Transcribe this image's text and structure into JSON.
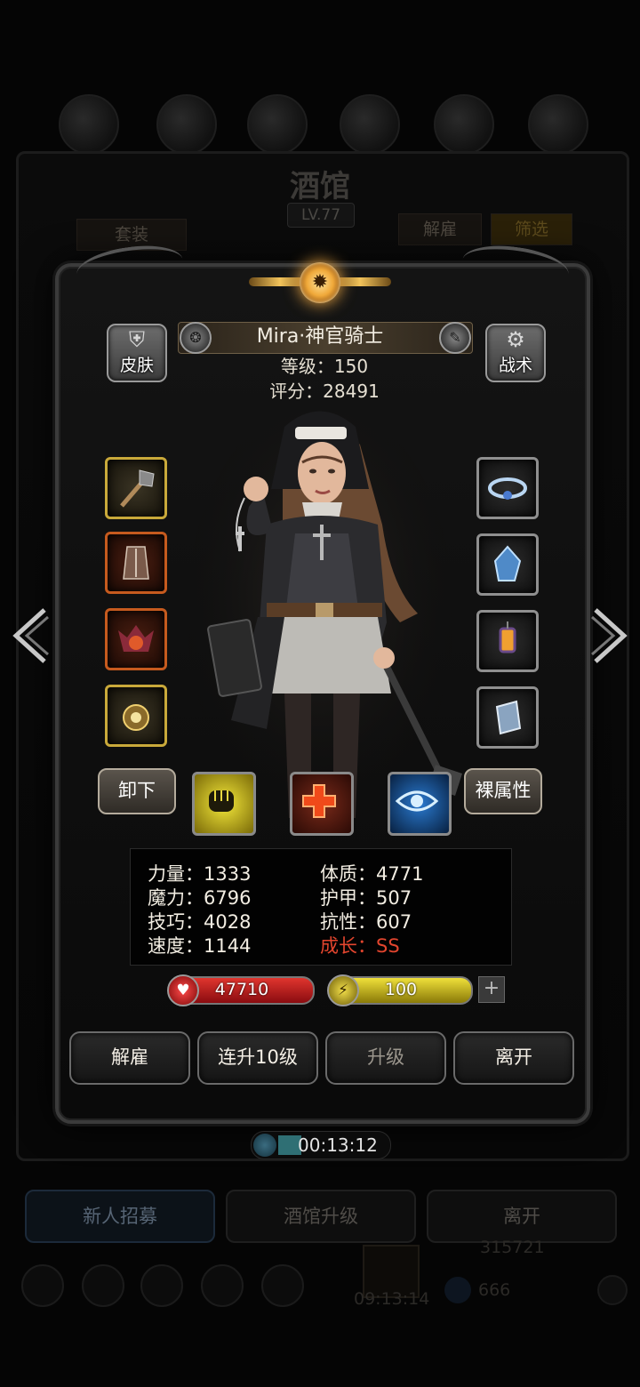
{
  "background": {
    "title": "酒馆",
    "level": "LV.77",
    "btn_set": "套装",
    "btn_dismiss": "解雇",
    "btn_filter": "筛选",
    "bottom_recruit": "新人招募",
    "bottom_upgrade": "酒馆升级",
    "bottom_leave": "离开",
    "gold_amount": "315721",
    "timer2": "09:13:14",
    "gem_amount": "666"
  },
  "hero": {
    "name": "Mira·神官骑士",
    "level_label": "等级：150",
    "score_label": "评分：28491",
    "skin_label": "皮肤",
    "tactics_label": "战术"
  },
  "equip_left": [
    {
      "icon": "mace-icon"
    },
    {
      "icon": "armor-icon"
    },
    {
      "icon": "demon-emblem-icon"
    },
    {
      "icon": "amulet-icon"
    }
  ],
  "equip_right": [
    {
      "icon": "circlet-icon"
    },
    {
      "icon": "crystal-icon"
    },
    {
      "icon": "lantern-icon"
    },
    {
      "icon": "book-icon"
    }
  ],
  "controls": {
    "unequip_label": "卸下",
    "naked_stats_label": "裸属性",
    "skills": [
      "fist-skill-icon",
      "heal-cross-skill-icon",
      "eye-skill-icon"
    ]
  },
  "stats": {
    "strength": "力量：1333",
    "constitution": "体质：4771",
    "magic": "魔力：6796",
    "armor": "护甲：507",
    "skill": "技巧：4028",
    "resistance": "抗性：607",
    "speed": "速度：1144",
    "growth": "成长：SS"
  },
  "bars": {
    "hp": "47710",
    "energy": "100",
    "plus": "+"
  },
  "actions": {
    "dismiss": "解雇",
    "level10": "连升10级",
    "levelup": "升级",
    "leave": "离开"
  },
  "timer": "00:13:12",
  "colors": {
    "growth_red": "#e2452e",
    "hp_red": "#c4161c",
    "energy_yellow": "#d6c21a",
    "gold_frame": "#c9a93a"
  }
}
